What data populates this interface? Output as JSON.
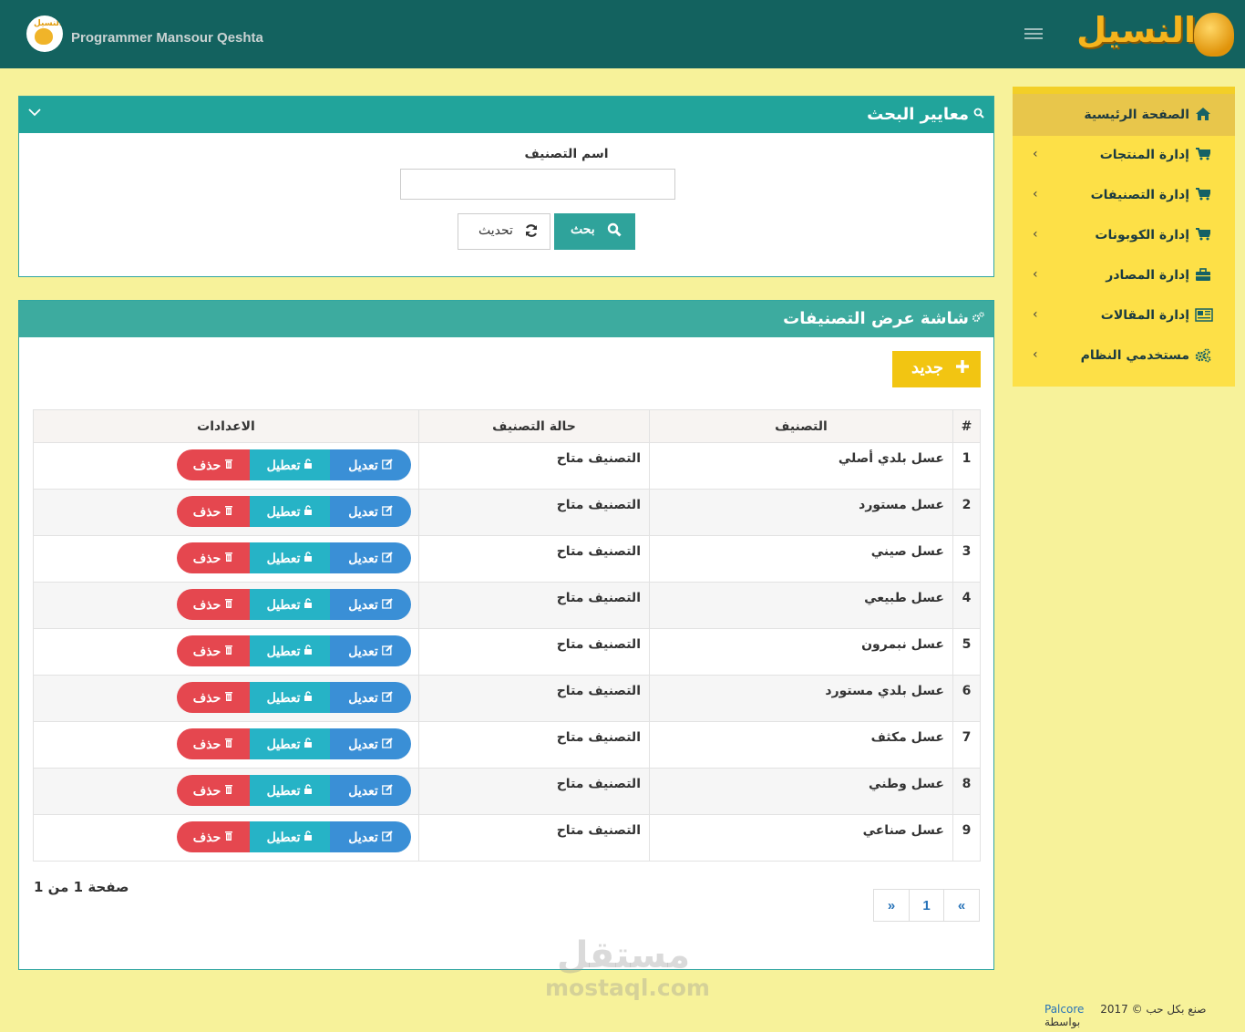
{
  "header": {
    "user_name": "Programmer Mansour Qeshta",
    "logo_text": "النسيل",
    "avatar_text": "النسيل"
  },
  "sidebar": {
    "items": [
      {
        "label": "الصفحة الرئيسية",
        "icon": "home-icon"
      },
      {
        "label": "إدارة المنتجات",
        "icon": "cart-icon"
      },
      {
        "label": "إدارة التصنيفات",
        "icon": "cart-icon"
      },
      {
        "label": "إدارة الكوبونات",
        "icon": "cart-icon"
      },
      {
        "label": "إدارة المصادر",
        "icon": "briefcase-icon"
      },
      {
        "label": "إدارة المقالات",
        "icon": "newspaper-icon"
      },
      {
        "label": "مستخدمي النظام",
        "icon": "gears-icon"
      }
    ]
  },
  "search_panel": {
    "title": "معايير البحث",
    "field_label": "اسم التصنيف",
    "field_value": "",
    "search_button": "بحث",
    "refresh_button": "تحديث"
  },
  "list_panel": {
    "title": "شاشة عرض التصنيفات",
    "new_button": "جديد",
    "columns": [
      "#",
      "التصنيف",
      "حالة التصنيف",
      "الاعدادات"
    ],
    "rows": [
      {
        "num": "1",
        "name": "عسل بلدي أصلي",
        "state": "التصنيف متاح"
      },
      {
        "num": "2",
        "name": "عسل مستورد",
        "state": "التصنيف متاح"
      },
      {
        "num": "3",
        "name": "عسل صيني",
        "state": "التصنيف متاح"
      },
      {
        "num": "4",
        "name": "عسل طبيعي",
        "state": "التصنيف متاح"
      },
      {
        "num": "5",
        "name": "عسل نبمرون",
        "state": "التصنيف متاح"
      },
      {
        "num": "6",
        "name": "عسل بلدي مستورد",
        "state": "التصنيف متاح"
      },
      {
        "num": "7",
        "name": "عسل مكثف",
        "state": "التصنيف متاح"
      },
      {
        "num": "8",
        "name": "عسل وطني",
        "state": "التصنيف متاح"
      },
      {
        "num": "9",
        "name": "عسل صناعي",
        "state": "التصنيف متاح"
      }
    ],
    "actions": {
      "edit": "تعديل",
      "disable": "تعطيل",
      "delete": "حذف"
    },
    "page_info": "صفحة 1 من 1",
    "pager": {
      "prev": "«",
      "current": "1",
      "next": "»"
    }
  },
  "watermark": {
    "arabic": "مستقل",
    "latin": "mostaql.com"
  },
  "footer": {
    "copyright": "2017 © صنع بكل حب بواسطة",
    "brand": "Palcore"
  },
  "colors": {
    "topbar": "#13625f",
    "background": "#f7f29a",
    "sidebar": "#fde047",
    "panel_header": "#21a49b",
    "edit": "#3a8fd6",
    "disable": "#26b3c6",
    "delete": "#e5474f",
    "new_button": "#f2c512"
  }
}
